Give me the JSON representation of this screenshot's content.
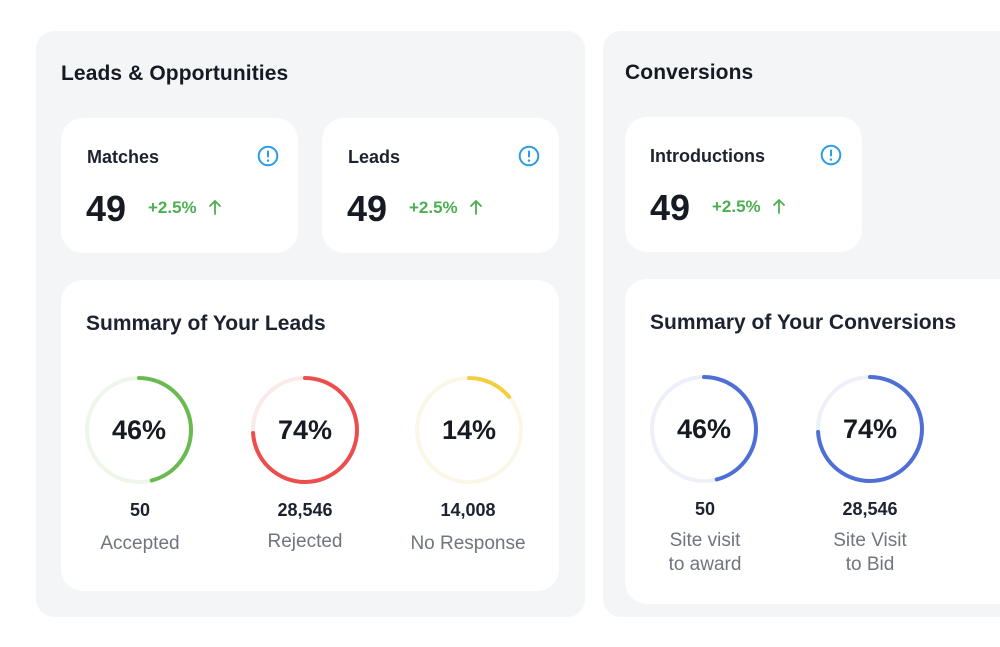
{
  "leads_panel": {
    "title": "Leads & Opportunities",
    "cards": [
      {
        "label": "Matches",
        "value": "49",
        "change": "+2.5%"
      },
      {
        "label": "Leads",
        "value": "49",
        "change": "+2.5%"
      }
    ],
    "summary": {
      "title": "Summary of Your Leads",
      "items": [
        {
          "percent_label": "46%",
          "percent": 46,
          "count": "50",
          "caption": "Accepted",
          "color": "#6abb4f",
          "track": "#eef6ea"
        },
        {
          "percent_label": "74%",
          "percent": 74,
          "count": "28,546",
          "caption": "Rejected",
          "color": "#eb4e4c",
          "track": "#fbeaea"
        },
        {
          "percent_label": "14%",
          "percent": 14,
          "count": "14,008",
          "caption": "No Response",
          "color": "#f2cf3e",
          "track": "#fbf7e6"
        }
      ]
    }
  },
  "conversions_panel": {
    "title": "Conversions",
    "cards": [
      {
        "label": "Introductions",
        "value": "49",
        "change": "+2.5%"
      }
    ],
    "summary": {
      "title": "Summary of Your Conversions",
      "items": [
        {
          "percent_label": "46%",
          "percent": 46,
          "count": "50",
          "caption_line1": "Site visit",
          "caption_line2": "to award",
          "color": "#4f6fd6",
          "track": "#eef0f9"
        },
        {
          "percent_label": "74%",
          "percent": 74,
          "count": "28,546",
          "caption_line1": "Site Visit",
          "caption_line2": "to Bid",
          "color": "#4f6fd6",
          "track": "#eef0f9"
        }
      ]
    }
  },
  "colors": {
    "info_icon": "#2a9ce6",
    "positive_change": "#4caf50",
    "panel_bg": "#f4f5f7"
  },
  "icons": {
    "info": "info-circle-icon",
    "trend": "arrow-up-icon"
  }
}
